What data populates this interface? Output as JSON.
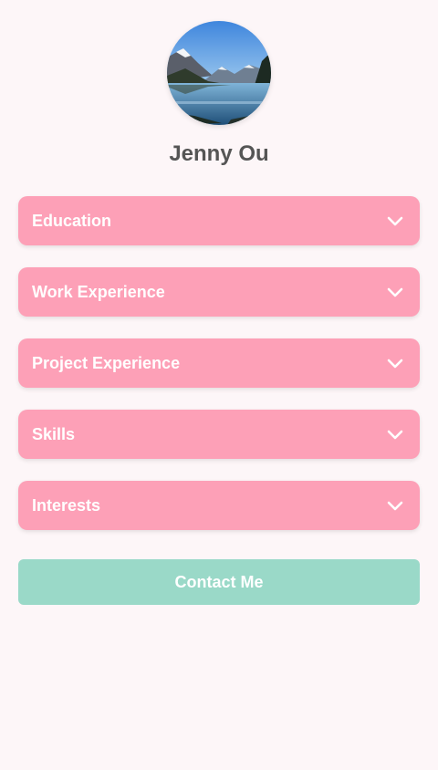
{
  "profile": {
    "name": "Jenny Ou",
    "avatar_icon": "mountain-lake-photo"
  },
  "sections": [
    {
      "label": "Education",
      "icon": "chevron-down-icon"
    },
    {
      "label": "Work Experience",
      "icon": "chevron-down-icon"
    },
    {
      "label": "Project Experience",
      "icon": "chevron-down-icon"
    },
    {
      "label": "Skills",
      "icon": "chevron-down-icon"
    },
    {
      "label": "Interests",
      "icon": "chevron-down-icon"
    }
  ],
  "contact": {
    "label": "Contact Me"
  },
  "colors": {
    "background": "#fdf6f8",
    "accordion": "#fda0b7",
    "contact_button": "#9ad9c8",
    "name_text": "#555555"
  }
}
